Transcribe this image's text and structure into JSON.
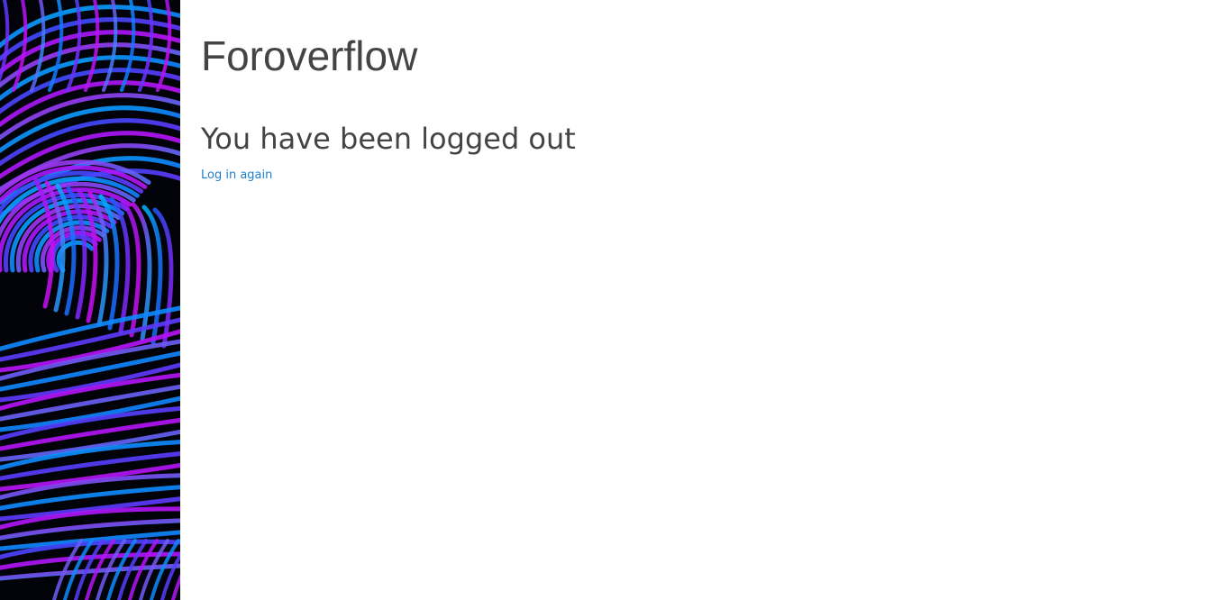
{
  "site": {
    "title": "Foroverflow"
  },
  "main": {
    "heading": "You have been logged out",
    "relogin_link": "Log in again"
  },
  "colors": {
    "background": "#ffffff",
    "title_text": "#444444",
    "heading_text": "#444444",
    "link": "#1e7fd0",
    "side_art_background": "#020308",
    "side_art_accents": [
      "#00b4ff",
      "#1e5bff",
      "#9b1bff",
      "#d10cf0"
    ]
  },
  "side_art": {
    "icon": "abstract-swirl-artwork"
  }
}
